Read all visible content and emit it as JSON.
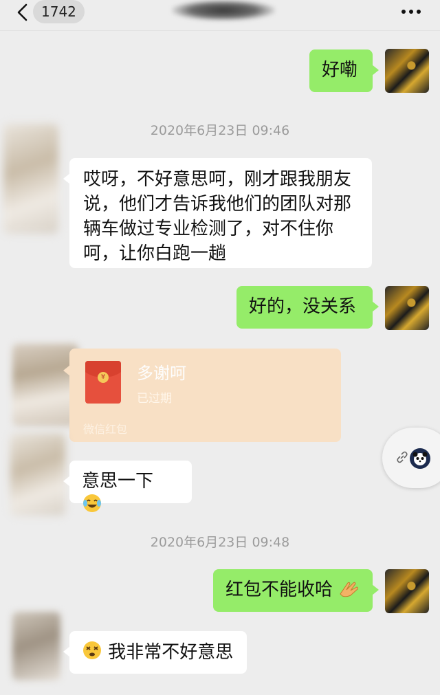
{
  "header": {
    "unread_count": "1742",
    "back_icon": "chevron-left-icon",
    "more_icon": "more-dots-icon"
  },
  "messages": [
    {
      "side": "me",
      "text": "好嘞"
    },
    {
      "type": "timestamp",
      "text": "2020年6月23日 09:46"
    },
    {
      "side": "them",
      "lines": [
        "哎呀，不好意思呵，刚才跟我朋友",
        "说，他们才告诉我他们的团队对那",
        "辆车做过专业检测了，对不住你",
        "呵，让你白跑一趟"
      ]
    },
    {
      "side": "me",
      "text": "好的，没关系"
    },
    {
      "side": "them",
      "type": "red_packet",
      "title": "多谢呵",
      "status": "已过期",
      "footer": "微信红包"
    },
    {
      "side": "them",
      "text": "意思一下",
      "emoji": "laughing-crying-emoji"
    },
    {
      "type": "timestamp",
      "text": "2020年6月23日 09:48"
    },
    {
      "side": "me",
      "text": "红包不能收哈",
      "emoji": "clapping-hands-emoji"
    },
    {
      "side": "them",
      "text": "我非常不好意思",
      "emoji": "dizzy-face-emoji"
    }
  ],
  "floating_widget": {
    "icons": [
      "link-icon",
      "panda-avatar-icon"
    ]
  },
  "colors": {
    "self_bubble": "#95ec69",
    "other_bubble": "#ffffff",
    "background": "#ededed",
    "red_packet": "#f8e0c5"
  }
}
